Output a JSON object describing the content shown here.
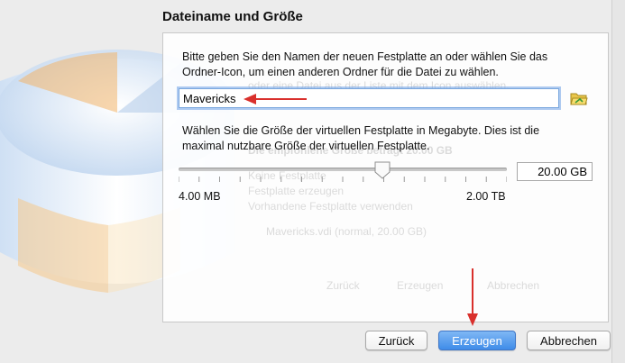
{
  "dialog": {
    "title": "Dateiname und Größe",
    "name_description_line1": "Bitte geben Sie den Namen der neuen Festplatte an oder wählen Sie das",
    "name_description_line2": "Ordner-Icon, um einen anderen Ordner für die Datei zu wählen.",
    "file_name_value": "Mavericks",
    "size_description_line1": "Wählen Sie die Größe der virtuellen Festplatte in Megabyte. Dies ist die",
    "size_description_line2": "maximal nutzbare Größe der virtuellen Festplatte.",
    "size_value": "20.00 GB",
    "size_fraction": 0.62,
    "slider_min_label": "4.00 MB",
    "slider_max_label": "2.00 TB"
  },
  "buttons": {
    "back": "Zurück",
    "create": "Erzeugen",
    "cancel": "Abbrechen"
  },
  "background_dialog": {
    "line1": "oder eine Datei aus der Liste mit dem Icon auswählen.",
    "line2": "Die empfohlene Größe beträgt 20.00 GB",
    "line3": "Keine Festplatte",
    "line4": "Festplatte erzeugen",
    "line5": "Vorhandene Festplatte verwenden",
    "line6": "Mavericks.vdi (normal, 20.00 GB)",
    "back": "Zurück",
    "create": "Erzeugen",
    "cancel": "Abbrechen"
  },
  "colors": {
    "annotation_arrow": "#d9302c",
    "primary_button": "#3f8ce8",
    "focus_ring": "#7aa7de"
  }
}
